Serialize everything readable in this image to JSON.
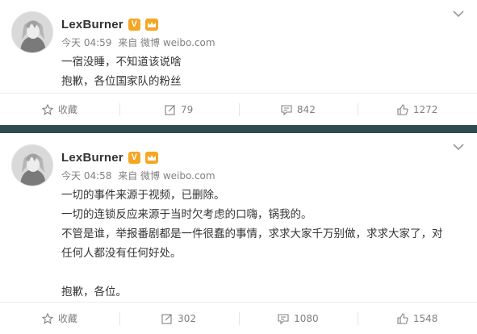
{
  "posts": [
    {
      "user": {
        "name": "LexBurner",
        "badge": "V"
      },
      "meta": {
        "time": "今天 04:59",
        "source": "来自 微博 weibo.com"
      },
      "lines": [
        "一宿没睡，不知道该说啥",
        "抱歉，各位国家队的粉丝"
      ],
      "actions": {
        "favorite": "收藏",
        "repost": "79",
        "comment": "842",
        "like": "1272"
      }
    },
    {
      "user": {
        "name": "LexBurner",
        "badge": "V"
      },
      "meta": {
        "time": "今天 04:58",
        "source": "来自 微博 weibo.com"
      },
      "lines": [
        "一切的事件来源于视频，已删除。",
        "一切的连锁反应来源于当时欠考虑的口嗨，锅我的。",
        "不管是谁，举报番剧都是一件很蠢的事情，求求大家千万别做，求求大家了，对",
        "任何人都没有任何好处。",
        "",
        "抱歉，各位。"
      ],
      "actions": {
        "favorite": "收藏",
        "repost": "302",
        "comment": "1080",
        "like": "1548"
      }
    }
  ],
  "icons": {
    "more": "chevron-down-icon",
    "favorite": "star-icon",
    "repost": "repost-icon",
    "comment": "comment-icon",
    "like": "thumbs-up-icon",
    "verified": "verified-badge-icon",
    "vip": "crown-icon"
  },
  "colors": {
    "name": "#333333",
    "meta": "#808080",
    "divider": "#2f4a52",
    "badge": "#f5a623"
  }
}
